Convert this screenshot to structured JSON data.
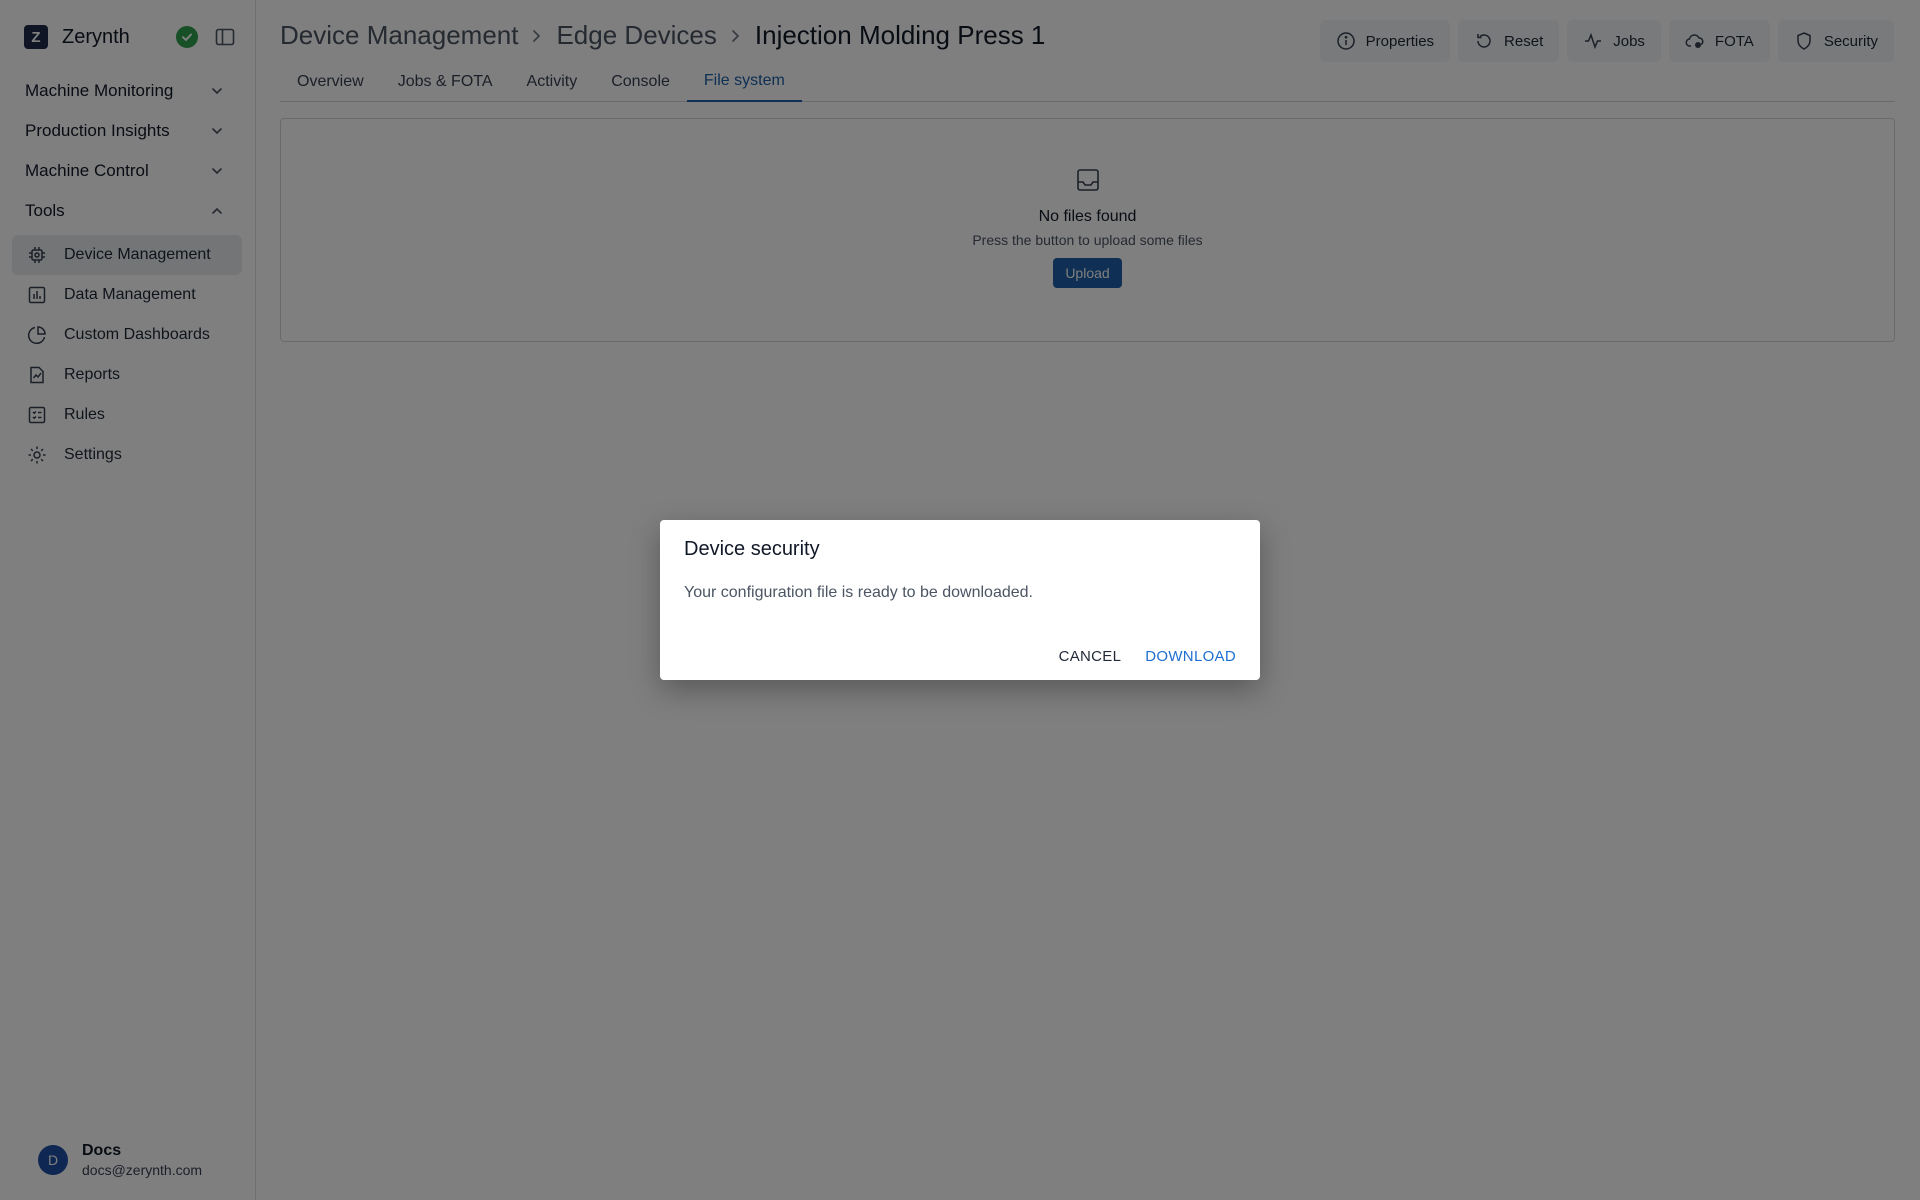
{
  "app": {
    "name": "Zerynth",
    "logo_glyph": "Z"
  },
  "sidebar": {
    "sections": [
      {
        "label": "Machine Monitoring",
        "expanded": false
      },
      {
        "label": "Production Insights",
        "expanded": false
      },
      {
        "label": "Machine Control",
        "expanded": false
      },
      {
        "label": "Tools",
        "expanded": true
      }
    ],
    "items": [
      {
        "label": "Device Management",
        "icon": "cpu-icon",
        "active": true
      },
      {
        "label": "Data Management",
        "icon": "chart-icon",
        "active": false
      },
      {
        "label": "Custom Dashboards",
        "icon": "pie-chart-icon",
        "active": false
      },
      {
        "label": "Reports",
        "icon": "report-icon",
        "active": false
      },
      {
        "label": "Rules",
        "icon": "rules-icon",
        "active": false
      },
      {
        "label": "Settings",
        "icon": "gear-icon",
        "active": false
      }
    ]
  },
  "user": {
    "initial": "D",
    "name": "Docs",
    "email": "docs@zerynth.com"
  },
  "breadcrumb": {
    "items": [
      "Device Management",
      "Edge Devices",
      "Injection Molding Press 1"
    ]
  },
  "actions": [
    {
      "label": "Properties",
      "icon": "info-icon"
    },
    {
      "label": "Reset",
      "icon": "reset-icon"
    },
    {
      "label": "Jobs",
      "icon": "activity-icon"
    },
    {
      "label": "FOTA",
      "icon": "cloud-icon"
    },
    {
      "label": "Security",
      "icon": "shield-icon"
    }
  ],
  "tabs": [
    {
      "label": "Overview",
      "active": false
    },
    {
      "label": "Jobs & FOTA",
      "active": false
    },
    {
      "label": "Activity",
      "active": false
    },
    {
      "label": "Console",
      "active": false
    },
    {
      "label": "File system",
      "active": true
    }
  ],
  "filesystem": {
    "empty_title": "No files found",
    "empty_subtitle": "Press the button to upload some files",
    "upload_label": "Upload"
  },
  "dialog": {
    "title": "Device security",
    "message": "Your configuration file is ready to be downloaded.",
    "cancel_label": "CANCEL",
    "download_label": "DOWNLOAD"
  },
  "colors": {
    "accent": "#1e5ea8",
    "status_ok": "#2e9e4f",
    "overlay": "rgba(0,0,0,0.5)"
  }
}
